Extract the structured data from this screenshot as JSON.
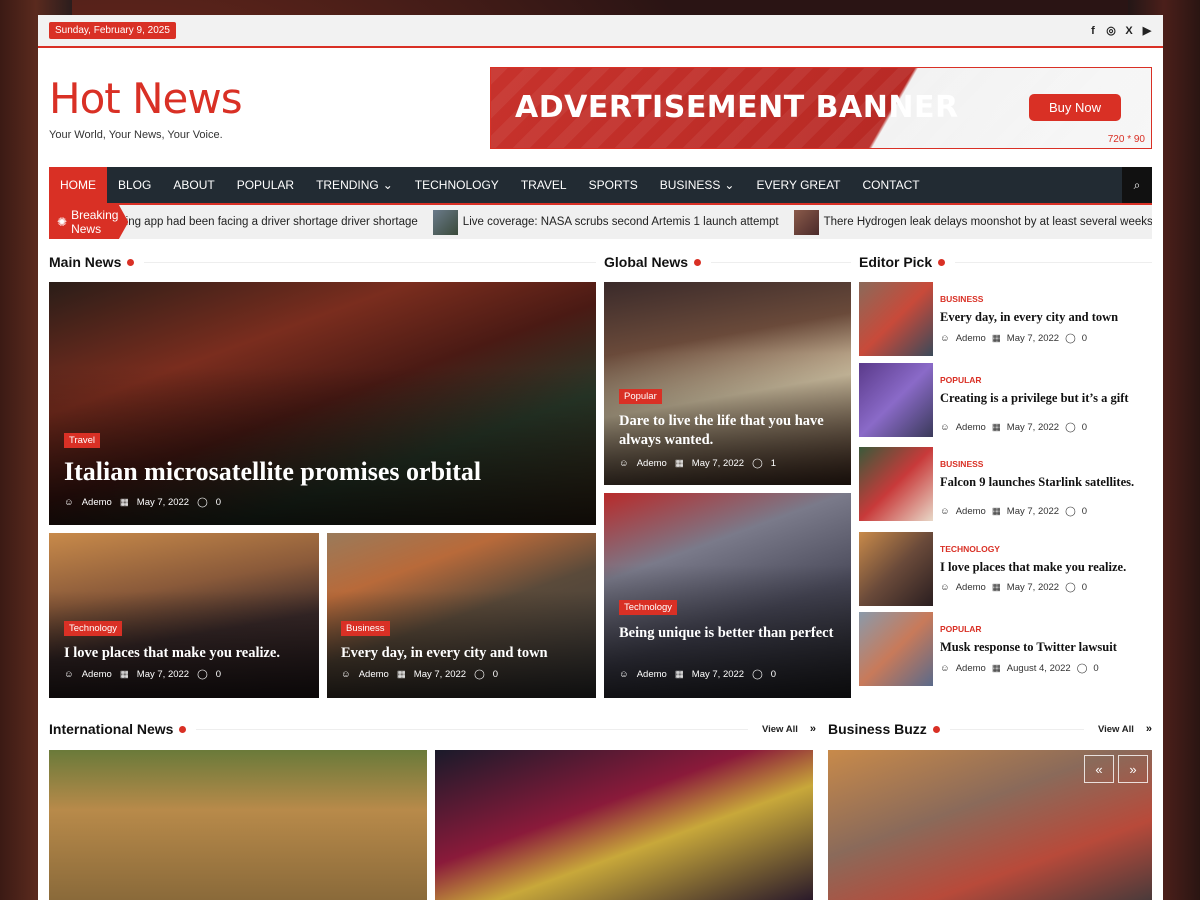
{
  "site": {
    "date": "Sunday, February 9, 2025",
    "title": "Hot News",
    "tagline": "Your World, Your News, Your Voice.",
    "accent": "#d93025"
  },
  "social": [
    "f",
    "◎",
    "X",
    "▶"
  ],
  "ad": {
    "headline": "ADVERTISEMENT BANNER",
    "button": "Buy Now",
    "size": "720 * 90"
  },
  "nav": [
    {
      "label": "HOME"
    },
    {
      "label": "BLOG"
    },
    {
      "label": "ABOUT"
    },
    {
      "label": "POPULAR"
    },
    {
      "label": "TRENDING"
    },
    {
      "label": "TECHNOLOGY"
    },
    {
      "label": "TRAVEL"
    },
    {
      "label": "SPORTS"
    },
    {
      "label": "BUSINESS"
    },
    {
      "label": "EVERY GREAT"
    },
    {
      "label": "CONTACT"
    }
  ],
  "ticker": {
    "label": "Breaking News",
    "items": [
      "ting app had been facing a driver shortage driver shortage",
      "Live coverage: NASA scrubs second Artemis 1 launch attempt",
      "There Hydrogen leak delays moonshot by at least several weeksis"
    ]
  },
  "sections": {
    "main": "Main News",
    "global": "Global News",
    "editor": "Editor Pick",
    "international": "International News",
    "buzz": "Business Buzz",
    "view_all": "View All"
  },
  "main_news": [
    {
      "cat": "Travel",
      "title": "Italian microsatellite promises orbital",
      "author": "Ademo",
      "date": "May 7, 2022",
      "comments": "0"
    },
    {
      "cat": "Technology",
      "title": "I love places that make you realize.",
      "author": "Ademo",
      "date": "May 7, 2022",
      "comments": "0"
    },
    {
      "cat": "Business",
      "title": "Every day, in every city and town",
      "author": "Ademo",
      "date": "May 7, 2022",
      "comments": "0"
    }
  ],
  "global_news": [
    {
      "cat": "Popular",
      "title": "Dare to live the life that you have always wanted.",
      "author": "Ademo",
      "date": "May 7, 2022",
      "comments": "1"
    },
    {
      "cat": "Technology",
      "title": "Being unique is better than perfect",
      "author": "Ademo",
      "date": "May 7, 2022",
      "comments": "0"
    }
  ],
  "editor_pick": [
    {
      "cat": "BUSINESS",
      "title": "Every day, in every city and town",
      "author": "Ademo",
      "date": "May 7, 2022",
      "comments": "0"
    },
    {
      "cat": "POPULAR",
      "title": "Creating is a privilege but it’s a gift",
      "author": "Ademo",
      "date": "May 7, 2022",
      "comments": "0"
    },
    {
      "cat": "BUSINESS",
      "title": "Falcon 9 launches Starlink satellites.",
      "author": "Ademo",
      "date": "May 7, 2022",
      "comments": "0"
    },
    {
      "cat": "TECHNOLOGY",
      "title": "I love places that make you realize.",
      "author": "Ademo",
      "date": "May 7, 2022",
      "comments": "0"
    },
    {
      "cat": "POPULAR",
      "title": "Musk response to Twitter lawsuit",
      "author": "Ademo",
      "date": "August 4, 2022",
      "comments": "0"
    }
  ],
  "buzz_arrows": {
    "prev": "«",
    "next": "»"
  }
}
